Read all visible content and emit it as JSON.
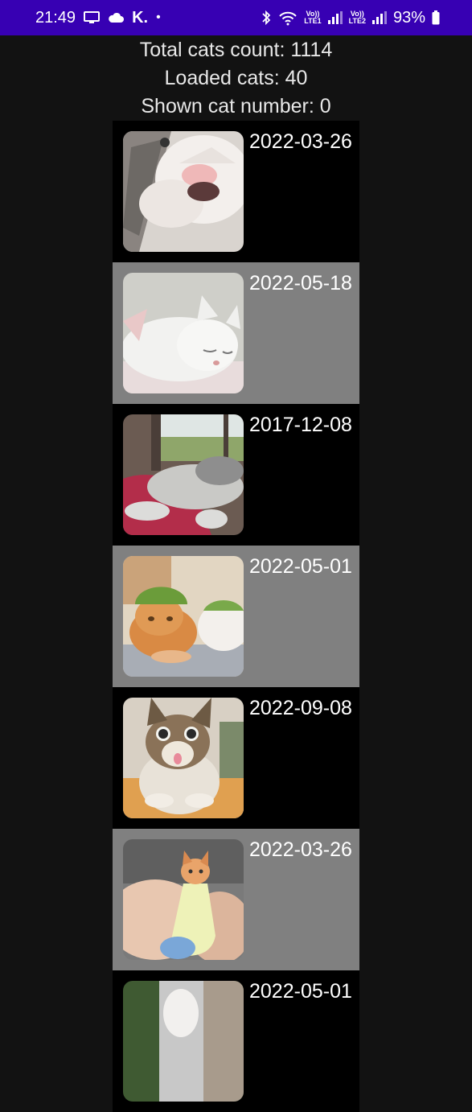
{
  "status_bar": {
    "time": "21:49",
    "carrier_glyph": "K.",
    "dot": "•",
    "lte1": "LTE1",
    "lte2": "LTE2",
    "volte": "Vo))",
    "battery": "93%",
    "icons": [
      "screen-cast-icon",
      "cloud-icon",
      "bluetooth-icon",
      "wifi-icon",
      "signal-icon",
      "battery-icon"
    ]
  },
  "header": {
    "total": "Total cats count: 1114",
    "loaded": "Loaded cats: 40",
    "shown": "Shown cat number: 0"
  },
  "cats": [
    {
      "date": "2022-03-26",
      "photo": "blurry white cat close-up",
      "bg": "dark"
    },
    {
      "date": "2022-05-18",
      "photo": "white cat sleeping",
      "bg": "gray"
    },
    {
      "date": "2017-12-08",
      "photo": "cat lying on red blanket",
      "bg": "dark"
    },
    {
      "date": "2022-05-01",
      "photo": "two cats with watermelon helmets",
      "bg": "gray"
    },
    {
      "date": "2022-09-08",
      "photo": "tabby kitten with tongue out",
      "bg": "dark"
    },
    {
      "date": "2022-03-26",
      "photo": "kitten in a sock",
      "bg": "gray"
    },
    {
      "date": "2022-05-01",
      "photo": "cat in a garden",
      "bg": "dark"
    }
  ],
  "colors": {
    "status_bar": "#3700b3",
    "background": "#121212",
    "row_dark": "#000000",
    "row_gray": "#808080"
  }
}
